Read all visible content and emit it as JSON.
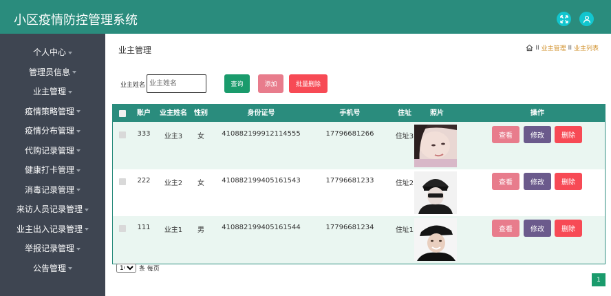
{
  "header": {
    "title": "小区疫情防控管理系统",
    "icons": [
      "fullscreen-icon",
      "user-icon"
    ],
    "bg_color": "#2a8c7d",
    "icon_color": "#12c6cf"
  },
  "sidebar": {
    "bg_color": "#3e4551",
    "items": [
      {
        "label": "个人中心"
      },
      {
        "label": "管理员信息"
      },
      {
        "label": "业主管理"
      },
      {
        "label": "疫情策略管理"
      },
      {
        "label": "疫情分布管理"
      },
      {
        "label": "代购记录管理"
      },
      {
        "label": "健康打卡管理"
      },
      {
        "label": "消毒记录管理"
      },
      {
        "label": "来访人员记录管理"
      },
      {
        "label": "业主出入记录管理"
      },
      {
        "label": "举报记录管理"
      },
      {
        "label": "公告管理"
      }
    ]
  },
  "main": {
    "page_title": "业主管理",
    "breadcrumb": {
      "sep": "II",
      "items": [
        "业主管理",
        "业主列表"
      ]
    },
    "search": {
      "label": "业主姓名",
      "placeholder": "业主姓名",
      "value": ""
    },
    "buttons": {
      "query": "查询",
      "add": "添加",
      "batch_delete": "批量删除"
    },
    "table": {
      "columns": [
        "账户",
        "业主姓名",
        "性别",
        "身份证号",
        "手机号",
        "住址",
        "照片",
        "操作"
      ],
      "actions": {
        "view": "查看",
        "edit": "修改",
        "delete": "删除"
      },
      "rows": [
        {
          "account": "333",
          "name": "业主3",
          "gender": "女",
          "id_card": "410882199912114555",
          "phone": "17796681266",
          "address": "住址3"
        },
        {
          "account": "222",
          "name": "业主2",
          "gender": "女",
          "id_card": "410882199405161543",
          "phone": "17796681233",
          "address": "住址2"
        },
        {
          "account": "111",
          "name": "业主1",
          "gender": "男",
          "id_card": "410882199405161544",
          "phone": "17796681234",
          "address": "住址1"
        }
      ]
    },
    "pagination": {
      "page_size": "10",
      "page_size_suffix": "条 每页",
      "current_page": "1"
    }
  }
}
